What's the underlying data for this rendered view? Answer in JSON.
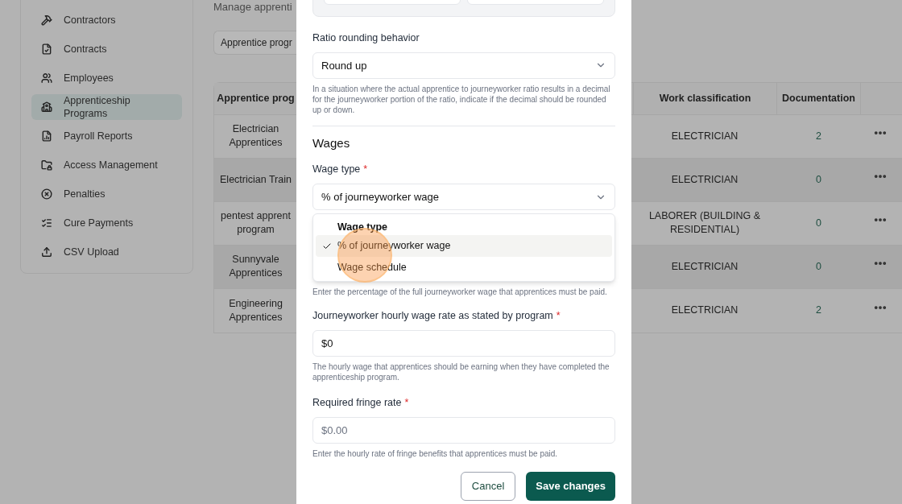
{
  "sidebar": {
    "items": [
      {
        "label": "Contractors",
        "selected": false
      },
      {
        "label": "Contracts",
        "selected": false
      },
      {
        "label": "Employees",
        "selected": false
      },
      {
        "label": "Apprenticeship Programs",
        "selected": true
      },
      {
        "label": "Payroll Reports",
        "selected": false
      },
      {
        "label": "Access Management",
        "selected": false
      },
      {
        "label": "Penalties",
        "selected": false
      },
      {
        "label": "Cure Payments",
        "selected": false
      },
      {
        "label": "CSV Upload",
        "selected": false
      }
    ]
  },
  "page": {
    "subtitle": "Manage apprenti",
    "tab": "Apprentice progr"
  },
  "table": {
    "columns": [
      "Apprentice prog",
      "Work classification",
      "Documentation"
    ],
    "rows": [
      {
        "program": [
          "Electrician",
          "Apprentices"
        ],
        "work_classification": [
          "ELECTRICIAN"
        ],
        "documentation": "2"
      },
      {
        "program": [
          "Electrician Train"
        ],
        "work_classification": [
          "ELECTRICIAN"
        ],
        "documentation": "0"
      },
      {
        "program": [
          "pentest apprent",
          "program"
        ],
        "work_classification": [
          "LABORER (BUILDING &",
          "RESIDENTIAL)"
        ],
        "documentation": "0"
      },
      {
        "program": [
          "Sunnyvale",
          "Apprentices"
        ],
        "work_classification": [
          "ELECTRICIAN"
        ],
        "documentation": "0"
      },
      {
        "program": [
          "Engineering",
          "Apprentices"
        ],
        "work_classification": [
          "ELECTRICIAN"
        ],
        "documentation": "2"
      }
    ]
  },
  "modal": {
    "rounding": {
      "label": "Ratio rounding behavior",
      "value": "Round up",
      "help": "In a situation where the actual apprentice to journeyworker ratio results in a decimal for the journeyworker portion of the ratio, indicate if the decimal should be rounded up or down."
    },
    "section": "Wages",
    "wage_type": {
      "label": "Wage type",
      "required_mark": "*",
      "value": "% of journeyworker wage",
      "menu_title": "Wage type",
      "options": [
        {
          "label": "% of journeyworker wage",
          "selected": true
        },
        {
          "label": "Wage schedule",
          "selected": false
        }
      ],
      "help": "Enter the percentage of the full journeyworker wage that apprentices must be paid."
    },
    "journey_rate": {
      "label": "Journeyworker hourly wage rate as stated by program",
      "required_mark": "*",
      "value": "$0",
      "help": "The hourly wage that apprentices should be earning when they have completed the apprenticeship program."
    },
    "fringe": {
      "label": "Required fringe rate",
      "required_mark": "*",
      "placeholder": "$0.00",
      "help": "Enter the hourly rate of fringe benefits that apprentices must be paid."
    },
    "buttons": {
      "cancel": "Cancel",
      "save": "Save changes"
    }
  }
}
